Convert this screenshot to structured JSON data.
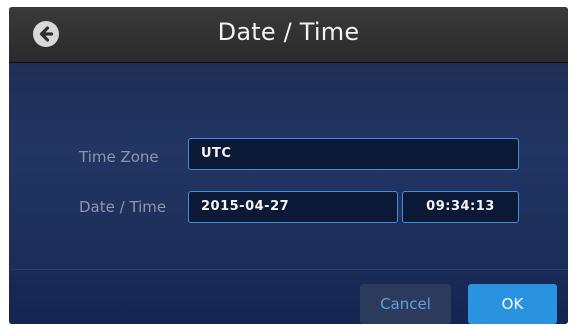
{
  "header": {
    "title": "Date / Time",
    "back_icon": "back-arrow-icon"
  },
  "form": {
    "time_zone_label": "Time Zone",
    "time_zone_value": "UTC",
    "date_time_label": "Date / Time",
    "date_value": "2015-04-27",
    "time_value": "09:34:13"
  },
  "footer": {
    "cancel_label": "Cancel",
    "ok_label": "OK"
  },
  "colors": {
    "accent": "#2a93e0",
    "field_border": "#3c8fd9",
    "titlebar": "#2f2f2f"
  }
}
